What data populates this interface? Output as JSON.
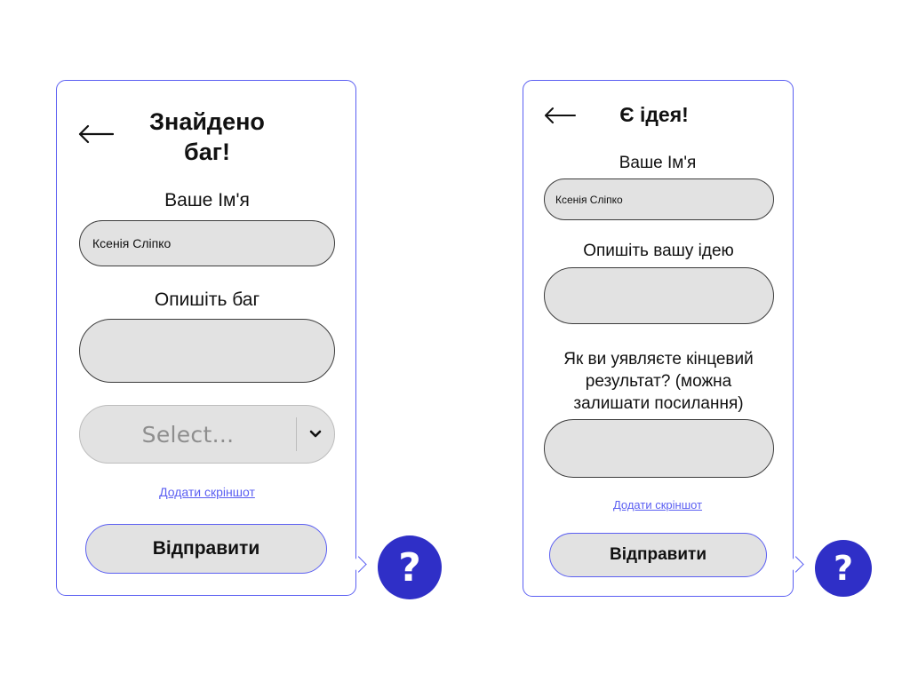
{
  "bug_form": {
    "title_line1": "Знайдено",
    "title_line2": "баг!",
    "name_label": "Ваше Ім'я",
    "name_value": "Ксенія Сліпко",
    "describe_label": "Опишіть баг",
    "describe_value": "",
    "select_placeholder": "Select...",
    "screenshot_link": "Додати скріншот",
    "submit_label": "Відправити",
    "help_label": "?"
  },
  "idea_form": {
    "title": "Є ідея!",
    "name_label": "Ваше Ім'я",
    "name_value": "Ксенія Сліпко",
    "describe_label": "Опишіть вашу ідею",
    "describe_value": "",
    "result_label_line1": "Як ви уявляєте кінцевий",
    "result_label_line2": "результат? (можна",
    "result_label_line3": "залишати посилання)",
    "result_value": "",
    "screenshot_link": "Додати скріншот",
    "submit_label": "Відправити",
    "help_label": "?"
  },
  "colors": {
    "accent": "#5b5ff2",
    "help_bg": "#2f2fc7",
    "field_bg": "#e2e2e2",
    "field_border": "#3c3c3c"
  },
  "icons": {
    "back": "arrow-left-icon",
    "chevron": "chevron-down-icon",
    "help": "question-icon"
  }
}
